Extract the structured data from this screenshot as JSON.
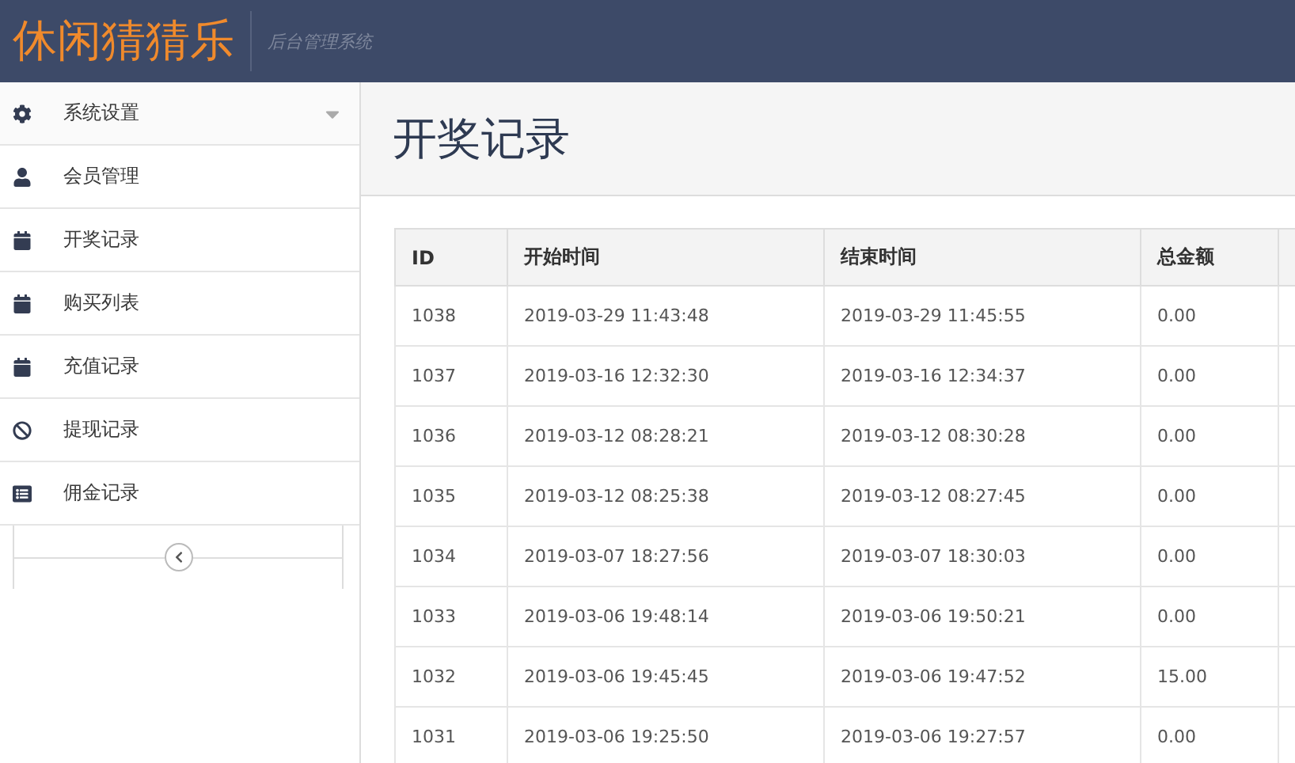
{
  "header": {
    "logo": "休闲猜猜乐",
    "subtitle": "后台管理系统"
  },
  "sidebar": {
    "items": [
      {
        "label": "系统设置",
        "kind": "submenu"
      },
      {
        "label": "会员管理",
        "kind": "link"
      },
      {
        "label": "开奖记录",
        "kind": "link"
      },
      {
        "label": "购买列表",
        "kind": "link"
      },
      {
        "label": "充值记录",
        "kind": "link"
      },
      {
        "label": "提现记录",
        "kind": "link"
      },
      {
        "label": "佣金记录",
        "kind": "link"
      }
    ]
  },
  "page_title": "开奖记录",
  "table": {
    "columns": [
      "ID",
      "开始时间",
      "结束时间",
      "总金额"
    ],
    "rows": [
      [
        "1038",
        "2019-03-29 11:43:48",
        "2019-03-29 11:45:55",
        "0.00"
      ],
      [
        "1037",
        "2019-03-16 12:32:30",
        "2019-03-16 12:34:37",
        "0.00"
      ],
      [
        "1036",
        "2019-03-12 08:28:21",
        "2019-03-12 08:30:28",
        "0.00"
      ],
      [
        "1035",
        "2019-03-12 08:25:38",
        "2019-03-12 08:27:45",
        "0.00"
      ],
      [
        "1034",
        "2019-03-07 18:27:56",
        "2019-03-07 18:30:03",
        "0.00"
      ],
      [
        "1033",
        "2019-03-06 19:48:14",
        "2019-03-06 19:50:21",
        "0.00"
      ],
      [
        "1032",
        "2019-03-06 19:45:45",
        "2019-03-06 19:47:52",
        "15.00"
      ],
      [
        "1031",
        "2019-03-06 19:25:50",
        "2019-03-06 19:27:57",
        "0.00"
      ]
    ]
  }
}
